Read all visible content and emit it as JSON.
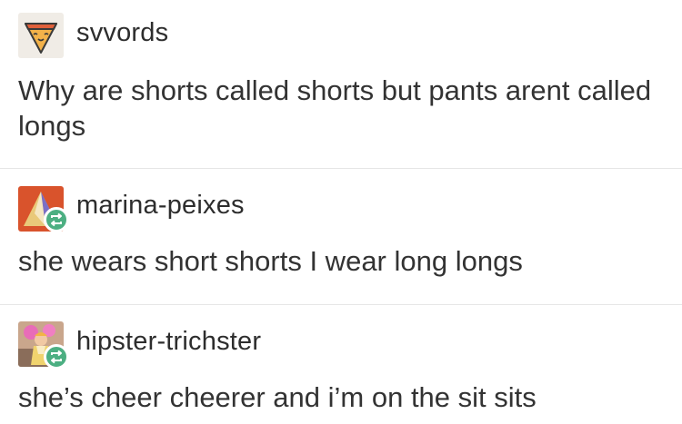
{
  "posts": [
    {
      "username": "svvords",
      "avatar_icon": "pizza-triangle-icon",
      "reblogged": false,
      "text": "Why are shorts called shorts but pants arent called longs"
    },
    {
      "username": "marina-peixes",
      "avatar_icon": "geometric-triangle-icon",
      "reblogged": true,
      "reblog_icon": "reblog-arrows-icon",
      "text": "she wears short shorts I wear long longs"
    },
    {
      "username": "hipster-trichster",
      "avatar_icon": "cheerleader-illustration-icon",
      "reblogged": true,
      "reblog_icon": "reblog-arrows-icon",
      "text": "she’s cheer cheerer and i’m on the sit sits"
    }
  ],
  "colors": {
    "reblog_badge": "#4caf82",
    "divider": "#e6e6e6",
    "text": "#333333"
  }
}
